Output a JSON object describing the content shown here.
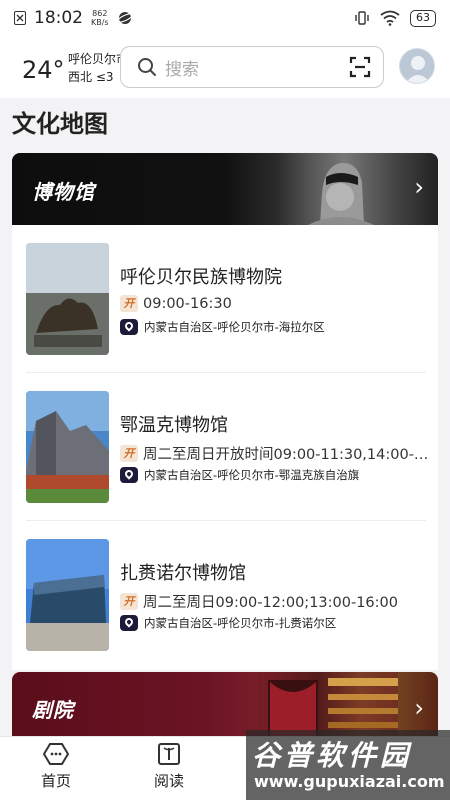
{
  "status_bar": {
    "time": "18:02",
    "speed_value": "862",
    "speed_unit": "KB/s",
    "battery": "63"
  },
  "header": {
    "weather": {
      "temperature": "24°",
      "city": "呼伦贝尔市",
      "wind": "西北 ≤3"
    },
    "search": {
      "placeholder": "搜索"
    }
  },
  "page": {
    "title": "文化地图"
  },
  "sections": {
    "museum": {
      "title": "博物馆",
      "items": [
        {
          "name": "呼伦贝尔民族博物院",
          "open_badge": "开",
          "hours": "09:00-16:30",
          "location": "内蒙古自治区-呼伦贝尔市-海拉尔区"
        },
        {
          "name": "鄂温克博物馆",
          "open_badge": "开",
          "hours": "周二至周日开放时间09:00-11:30,14:00-…",
          "location": "内蒙古自治区-呼伦贝尔市-鄂温克族自治旗"
        },
        {
          "name": "扎赉诺尔博物馆",
          "open_badge": "开",
          "hours": "周二至周日09:00-12:00;13:00-16:00",
          "location": "内蒙古自治区-呼伦贝尔市-扎赉诺尔区"
        }
      ]
    },
    "theater": {
      "title": "剧院"
    }
  },
  "bottom_nav": {
    "items": [
      {
        "label": "首页",
        "icon": "home-icon"
      },
      {
        "label": "阅读",
        "icon": "book-icon"
      }
    ]
  },
  "watermark": {
    "cn": "谷普软件园",
    "en": "www.gupuxiazai.com"
  }
}
